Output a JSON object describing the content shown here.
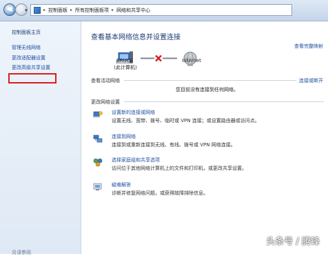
{
  "breadcrumb": [
    "控制面板",
    "所有控制面板项",
    "网络和共享中心"
  ],
  "sidebar": {
    "home": "控制面板主页",
    "links": [
      "管理无线网络",
      "更改适配器设置",
      "更改高级共享设置"
    ],
    "see_also": "另请参阅"
  },
  "main": {
    "title": "查看基本网络信息并设置连接",
    "full_map": "查看完整映射",
    "computer_name": "BRUCE",
    "computer_sub": "(此计算机)",
    "internet": "Internet",
    "active_networks_label": "查看活动网络",
    "connect_or_disconnect": "连接或断开",
    "no_connection": "您目前没有连接到任何网络。",
    "change_settings_label": "更改网络设置",
    "tasks": [
      {
        "title": "设置新的连接或网络",
        "desc": "设置无线、宽带、拨号、临时或 VPN 连接；或设置路由器或访问点。",
        "icon": "new-connection-icon"
      },
      {
        "title": "连接到网络",
        "desc": "连接到或重新连接到无线、有线、拨号或 VPN 网络连接。",
        "icon": "connect-network-icon"
      },
      {
        "title": "选择家庭组和共享选项",
        "desc": "访问位于其他网络计算机上的文件和打印机，或更改共享设置。",
        "icon": "homegroup-icon"
      },
      {
        "title": "疑难解答",
        "desc": "诊断并修复网络问题，或获得故障排除信息。",
        "icon": "troubleshoot-icon"
      }
    ]
  },
  "watermark": "头条号 / 腾锋",
  "colors": {
    "link": "#1e4fa0",
    "highlight": "#d81d1d",
    "title": "#1b3a75"
  }
}
